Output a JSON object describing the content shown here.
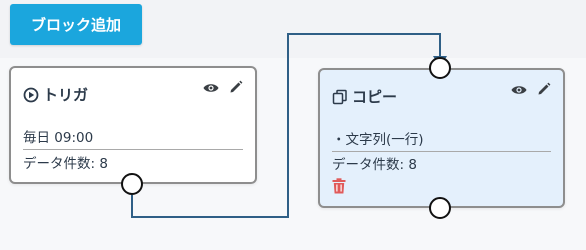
{
  "toolbar": {
    "add_block_label": "ブロック追加"
  },
  "nodes": {
    "trigger": {
      "title": "トリガ",
      "schedule": "毎日 09:00",
      "data_count": "データ件数: 8"
    },
    "copy": {
      "title": "コピー",
      "text_field": "・文字列(一行)",
      "data_count": "データ件数: 8"
    }
  },
  "colors": {
    "accent_button": "#1ba6dd",
    "connector_line": "#2f5f86",
    "copy_node_bg": "#e4f0fc",
    "delete_icon": "#e05a5a"
  },
  "icons": [
    "play-circle-icon",
    "copy-icon",
    "eye-icon",
    "pencil-icon",
    "trash-icon"
  ]
}
